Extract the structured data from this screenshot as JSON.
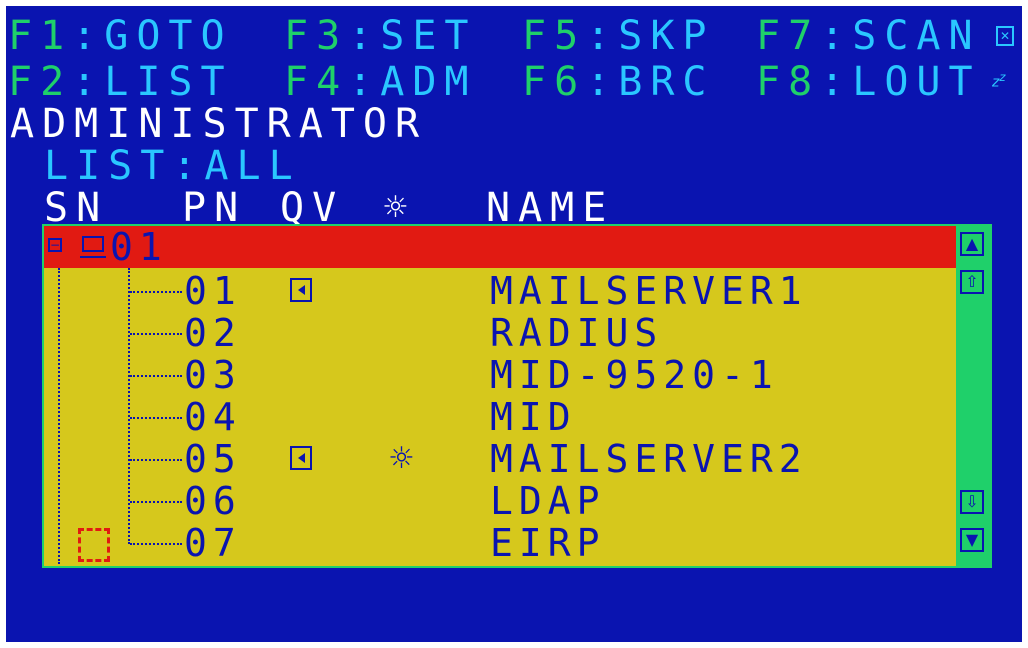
{
  "fkeys": {
    "f1": {
      "key": "F1",
      "sep": ":",
      "label": "GOTO"
    },
    "f3": {
      "key": "F3",
      "sep": ":",
      "label": "SET"
    },
    "f5": {
      "key": "F5",
      "sep": ":",
      "label": "SKP"
    },
    "f7": {
      "key": "F7",
      "sep": ":",
      "label": "SCAN"
    },
    "f2": {
      "key": "F2",
      "sep": ":",
      "label": "LIST"
    },
    "f4": {
      "key": "F4",
      "sep": ":",
      "label": "ADM"
    },
    "f6": {
      "key": "F6",
      "sep": ":",
      "label": "BRC"
    },
    "f8": {
      "key": "F8",
      "sep": ":",
      "label": "LOUT"
    }
  },
  "user": "ADMINISTRATOR",
  "list_filter": "LIST:ALL",
  "columns": {
    "sn": "SN",
    "pn": "PN",
    "qv": "QV",
    "power": "☼",
    "name": "NAME"
  },
  "station": {
    "number": "01"
  },
  "ports": [
    {
      "pn": "01",
      "qv": true,
      "powered": false,
      "name": "MAILSERVER1"
    },
    {
      "pn": "02",
      "qv": false,
      "powered": false,
      "name": "RADIUS"
    },
    {
      "pn": "03",
      "qv": false,
      "powered": false,
      "name": "MID-9520-1"
    },
    {
      "pn": "04",
      "qv": false,
      "powered": false,
      "name": "MID"
    },
    {
      "pn": "05",
      "qv": true,
      "powered": true,
      "name": "MAILSERVER2"
    },
    {
      "pn": "06",
      "qv": false,
      "powered": false,
      "name": "LDAP"
    },
    {
      "pn": "07",
      "qv": false,
      "powered": false,
      "name": "EIRP"
    }
  ],
  "scroll": {
    "top": "▲",
    "page_up": "⇧",
    "page_down": "⇩",
    "bottom": "▼"
  },
  "colors": {
    "background": "#0a14b0",
    "function_key": "#1fd06a",
    "function_label": "#2ac7ff",
    "list_bg": "#d6c81c",
    "highlight": "#e11a12",
    "scrollbar": "#1fd06a"
  }
}
